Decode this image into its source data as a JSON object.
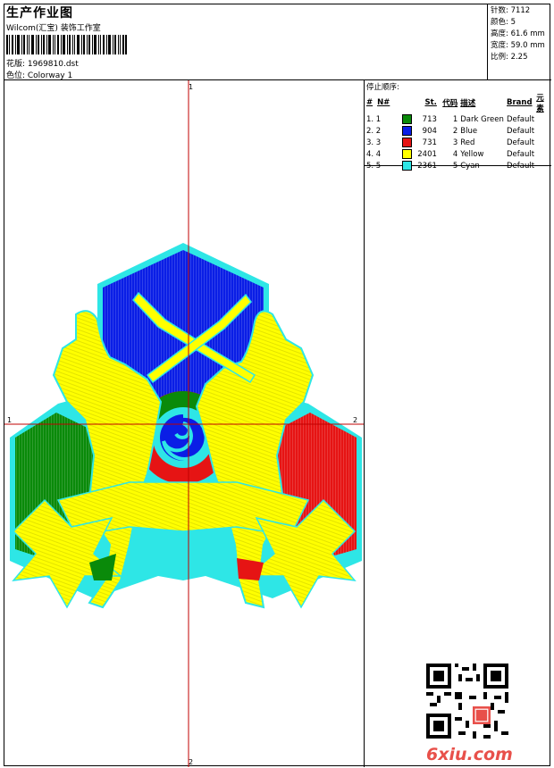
{
  "header": {
    "title": "生产作业图",
    "company": "Wilcom(汇宝) 装饰工作室",
    "design": "花版: 1969810.dst",
    "colorway": "色位: Colorway 1"
  },
  "stats": {
    "stitches": "针数: 7112",
    "colors": "颜色: 5",
    "height": "高度: 61.6 mm",
    "width": "宽度: 59.0 mm",
    "ratio": "比例: 2.25"
  },
  "axes": {
    "top": "1",
    "bottom": "2",
    "left": "1",
    "right": "2"
  },
  "sequence": {
    "title": "停止顺序:",
    "headers": {
      "index": "#",
      "needle": "N#",
      "st": "St.",
      "code": "代码",
      "desc": "描述",
      "brand": "Brand",
      "element": "元素"
    },
    "rows": [
      {
        "index": "1. 1",
        "color": "#0a8a0a",
        "st": "713",
        "code": "1",
        "desc": "Dark Green",
        "brand": "Default"
      },
      {
        "index": "2. 2",
        "color": "#0a1ee6",
        "st": "904",
        "code": "2",
        "desc": "Blue",
        "brand": "Default"
      },
      {
        "index": "3. 3",
        "color": "#e61414",
        "st": "731",
        "code": "3",
        "desc": "Red",
        "brand": "Default"
      },
      {
        "index": "4. 4",
        "color": "#ffff00",
        "st": "2401",
        "code": "4",
        "desc": "Yellow",
        "brand": "Default"
      },
      {
        "index": "5. 5",
        "color": "#2ee6e6",
        "st": "2361",
        "code": "5",
        "desc": "Cyan",
        "brand": "Default"
      }
    ]
  },
  "watermark": "6xiu.com"
}
